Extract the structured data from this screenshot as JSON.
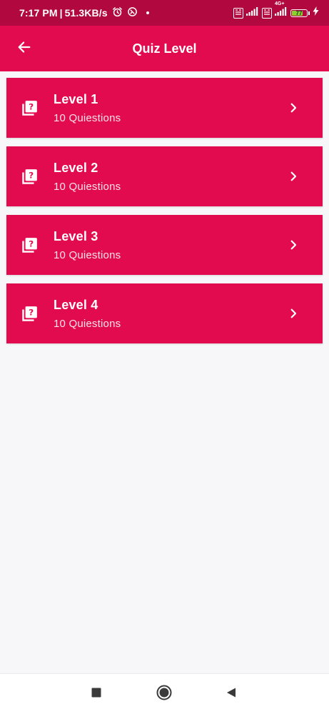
{
  "status_bar": {
    "time": "7:17 PM",
    "separator": "|",
    "net_speed": "51.3KB/s",
    "battery_level": "77",
    "battery_percent": 77,
    "network_label": "4G+",
    "icons": [
      "alarm-icon",
      "data-saver-icon",
      "volte-icon",
      "signal-icon",
      "battery-icon",
      "charging-icon"
    ]
  },
  "app_bar": {
    "title": "Quiz Level",
    "back_icon": "arrow-left-icon"
  },
  "levels": [
    {
      "title": "Level 1",
      "subtitle": "10 Quiestions"
    },
    {
      "title": "Level 2",
      "subtitle": "10 Quiestions"
    },
    {
      "title": "Level 3",
      "subtitle": "10 Quiestions"
    },
    {
      "title": "Level 4",
      "subtitle": "10 Quiestions"
    }
  ],
  "nav_bar": {
    "buttons": [
      "recent-apps-icon",
      "home-icon",
      "back-icon"
    ]
  },
  "colors": {
    "status_bar": "#b0083f",
    "primary": "#e30b4f",
    "background": "#f7f7f9",
    "battery_fill": "#8bd22c"
  }
}
